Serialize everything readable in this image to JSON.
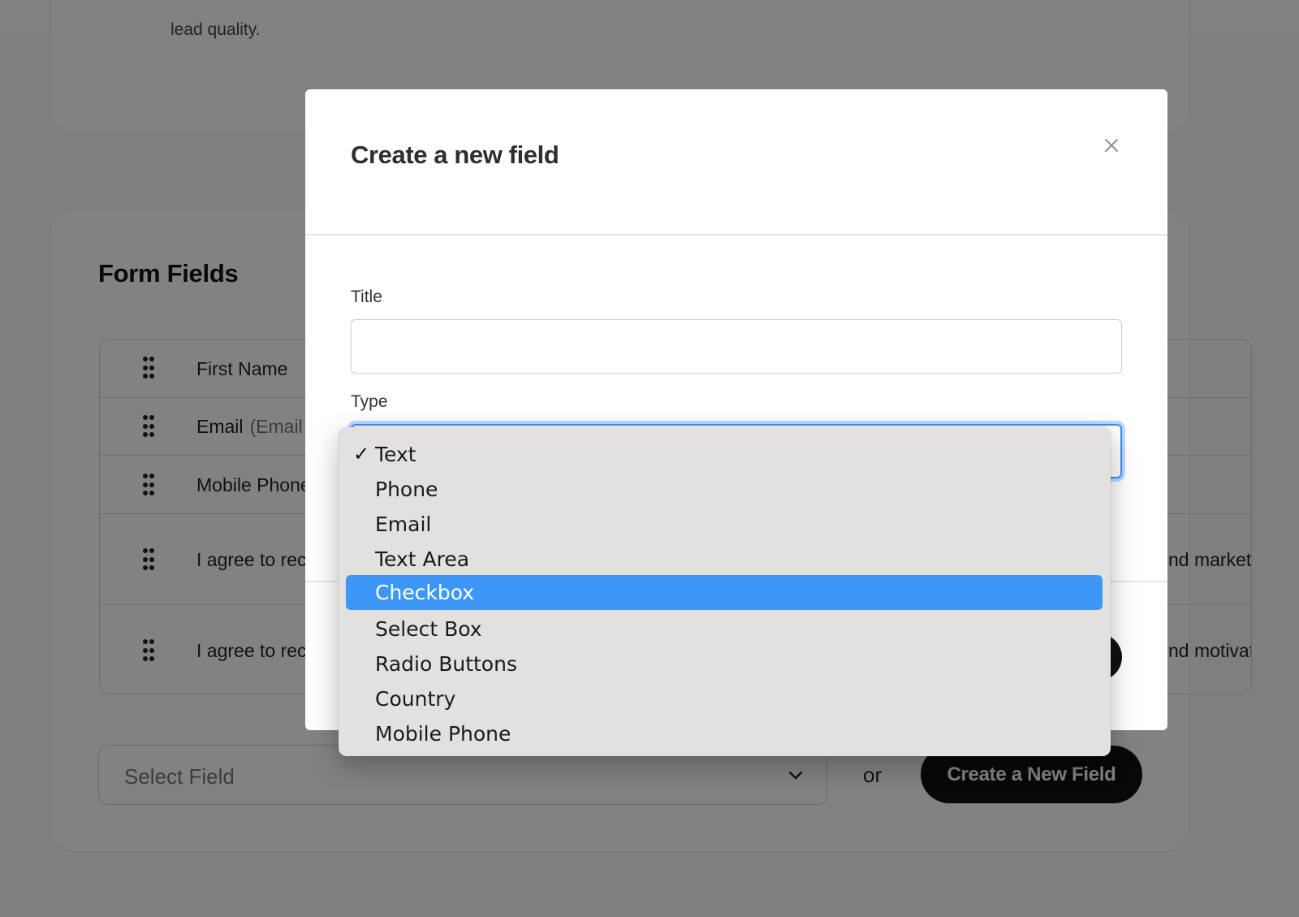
{
  "background": {
    "top_card_text": "lead quality.",
    "form_fields_title": "Form Fields",
    "fields": [
      {
        "label": "First Name",
        "sub": "",
        "tail": ""
      },
      {
        "label": "Email",
        "sub": "(Email",
        "tail": ""
      },
      {
        "label": "Mobile Phone",
        "sub": "",
        "tail": ""
      },
      {
        "label": "I agree to rec",
        "sub": "",
        "tail": "nd marketing"
      },
      {
        "label": "I agree to rec",
        "sub": "",
        "tail": "nd motivatio"
      }
    ],
    "select_field_placeholder": "Select Field",
    "or_text": "or",
    "create_button_label": "Create a New Field"
  },
  "modal": {
    "title": "Create a new field",
    "close_icon": "close-icon",
    "title_label": "Title",
    "title_value": "",
    "type_label": "Type"
  },
  "dropdown": {
    "selected": "Text",
    "highlighted": "Checkbox",
    "options": [
      "Text",
      "Phone",
      "Email",
      "Text Area",
      "Checkbox",
      "Select Box",
      "Radio Buttons",
      "Country",
      "Mobile Phone"
    ]
  },
  "colors": {
    "overlay": "#000000",
    "highlight": "#3d97f7",
    "focus_ring": "#3a8dff",
    "primary_button": "#111111"
  }
}
